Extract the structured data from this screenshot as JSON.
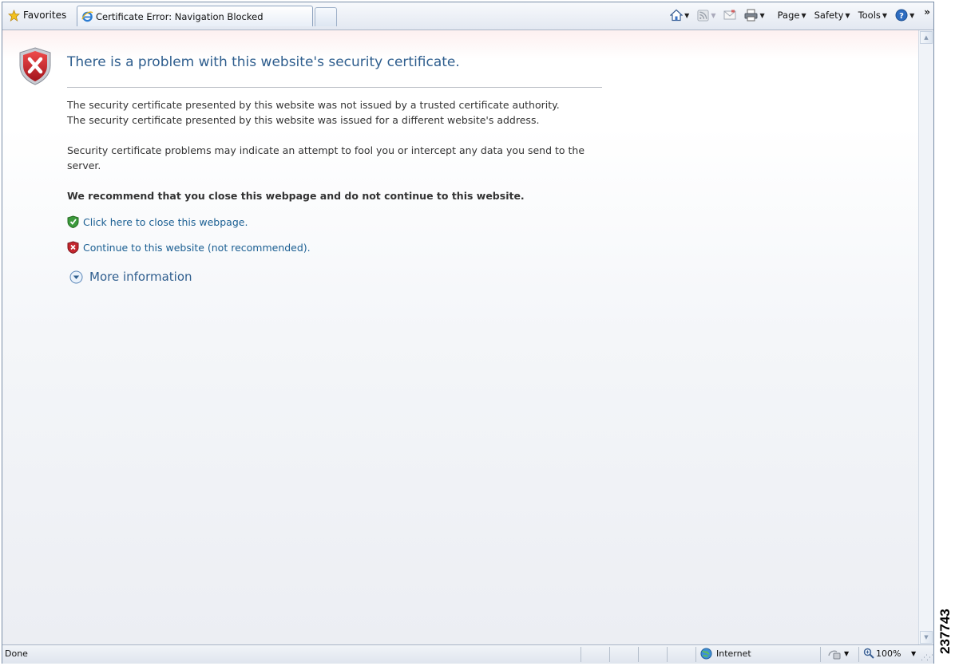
{
  "toolbar": {
    "favorites_label": "Favorites",
    "tab_title": "Certificate Error: Navigation Blocked",
    "page_label": "Page",
    "safety_label": "Safety",
    "tools_label": "Tools",
    "overflow_glyph": "»"
  },
  "icons": {
    "favorites": "star-icon",
    "tab": "ie-logo-icon",
    "home": "home-icon",
    "feeds": "rss-feed-icon",
    "mail": "mail-icon",
    "print": "printer-icon",
    "help": "help-icon",
    "error": "shield-x-icon",
    "close_option": "shield-check-icon",
    "continue_option": "shield-x-small-icon",
    "more_info": "expand-circle-icon",
    "zone": "globe-icon",
    "zoom": "magnifier-icon"
  },
  "content": {
    "title": "There is a problem with this website's security certificate.",
    "line1": "The security certificate presented by this website was not issued by a trusted certificate authority.",
    "line2": "The security certificate presented by this website was issued for a different website's address.",
    "warning": "Security certificate problems may indicate an attempt to fool you or intercept any data you send to the server.",
    "recommendation": "We recommend that you close this webpage and do not continue to this website.",
    "close_link": "Click here to close this webpage.",
    "continue_link": "Continue to this website (not recommended).",
    "more_info": "More information"
  },
  "status": {
    "text": "Done",
    "zone": "Internet",
    "zoom": "100%"
  },
  "figure_id": "237743",
  "colors": {
    "title_blue": "#2f5e8e",
    "link_blue": "#1a5e92",
    "error_red": "#c4262e",
    "safe_green": "#3c9a3c"
  }
}
